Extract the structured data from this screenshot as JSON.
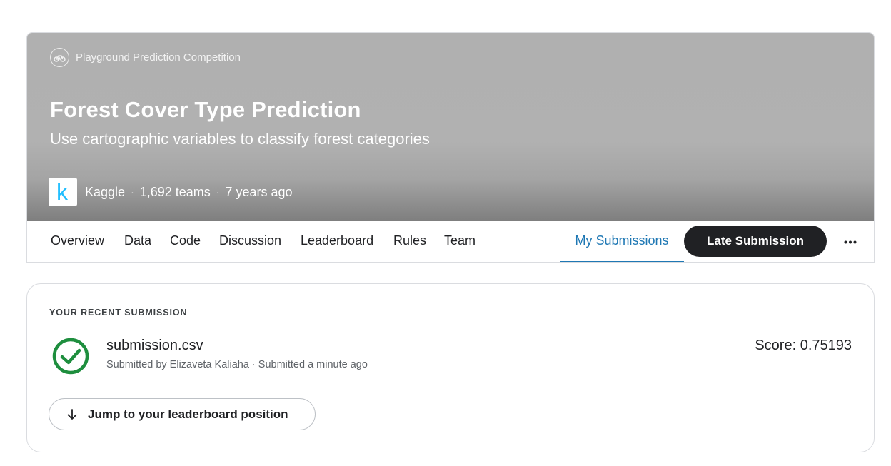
{
  "competition": {
    "type_label": "Playground Prediction Competition",
    "title": "Forest Cover Type Prediction",
    "subtitle": "Use cartographic variables to classify forest categories",
    "host": "Kaggle",
    "host_logo_letter": "k",
    "teams": "1,692 teams",
    "age": "7 years ago",
    "separator": "·"
  },
  "tabs": [
    {
      "label": "Overview"
    },
    {
      "label": "Data"
    },
    {
      "label": "Code"
    },
    {
      "label": "Discussion"
    },
    {
      "label": "Leaderboard"
    },
    {
      "label": "Rules"
    },
    {
      "label": "Team"
    },
    {
      "label": "My Submissions",
      "active": true
    }
  ],
  "actions": {
    "late_submission": "Late Submission",
    "more_icon": "more-horizontal-icon"
  },
  "recent_submission": {
    "section_label": "YOUR RECENT SUBMISSION",
    "status_icon": "check-circle-icon",
    "file_name": "submission.csv",
    "meta": "Submitted by Elizaveta Kaliaha · Submitted a minute ago",
    "score": "Score: 0.75193",
    "jump_button": "Jump to your leaderboard position",
    "jump_icon": "arrow-down-icon"
  },
  "colors": {
    "accent": "#1f78b4",
    "success": "#1e8e3e",
    "primary_button": "#202124",
    "kaggle_blue": "#20beff"
  }
}
